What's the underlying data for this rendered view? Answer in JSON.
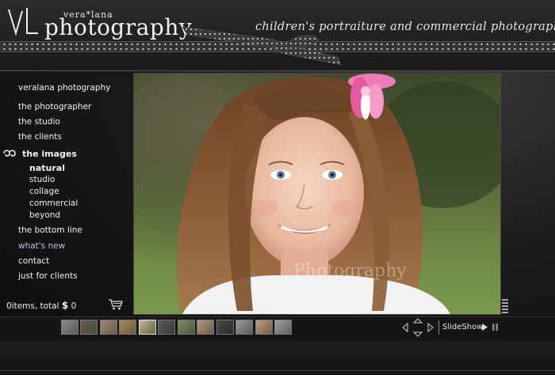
{
  "brand": {
    "top": "vera*lana",
    "main": "photography",
    "tagline": "children's portraiture and commercial photography"
  },
  "nav": {
    "items": [
      {
        "label": "veralana photography"
      },
      {
        "label": "the photographer"
      },
      {
        "label": "the studio"
      },
      {
        "label": "the clients"
      },
      {
        "label": "the images"
      },
      {
        "label": "the bottom line"
      },
      {
        "label": "what's new"
      },
      {
        "label": "contact"
      },
      {
        "label": "just for clients"
      }
    ],
    "subitems": [
      {
        "label": "natural"
      },
      {
        "label": "studio"
      },
      {
        "label": "collage"
      },
      {
        "label": "commercial"
      },
      {
        "label": "beyond"
      }
    ],
    "active_item": "the images",
    "active_subitem": "natural"
  },
  "cart": {
    "count_text": "0items, total",
    "currency": "$",
    "amount": "0"
  },
  "photo": {
    "watermark": "Photography"
  },
  "thumbnails": {
    "count": 12,
    "selected_index": 4
  },
  "slideshow": {
    "label": "SlideShow"
  },
  "colors": {
    "accent_link": "#b9c4e8",
    "text": "#f2f2f2",
    "background": "#111111"
  }
}
